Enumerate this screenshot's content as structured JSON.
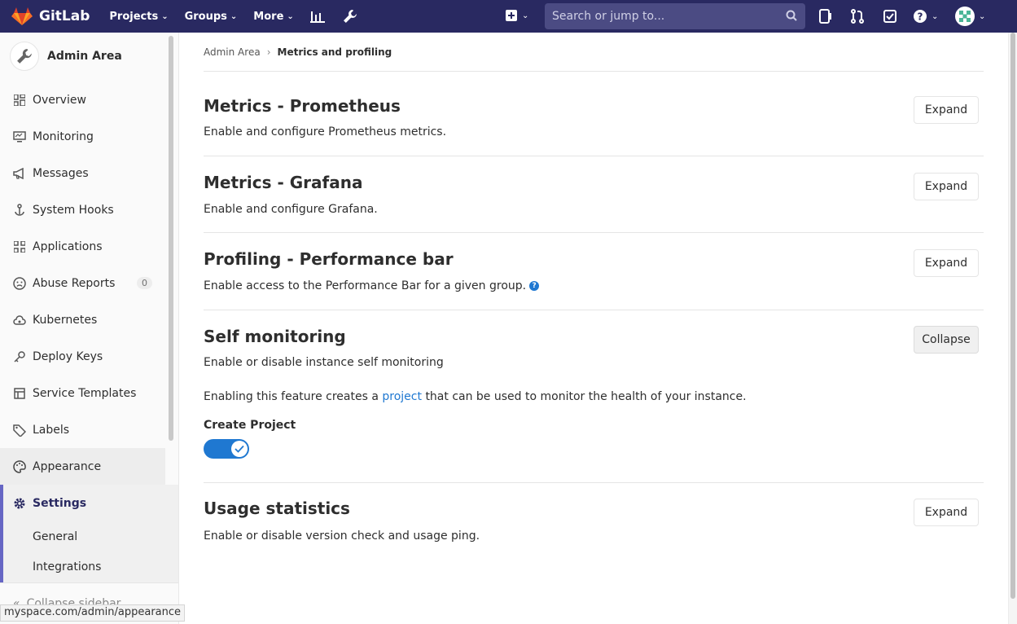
{
  "navbar": {
    "brand": "GitLab",
    "projects": "Projects",
    "groups": "Groups",
    "more": "More",
    "search_placeholder": "Search or jump to..."
  },
  "sidebar": {
    "title": "Admin Area",
    "items": [
      {
        "label": "Overview",
        "icon": "overview-icon"
      },
      {
        "label": "Monitoring",
        "icon": "monitor-icon"
      },
      {
        "label": "Messages",
        "icon": "megaphone-icon"
      },
      {
        "label": "System Hooks",
        "icon": "hook-icon"
      },
      {
        "label": "Applications",
        "icon": "applications-icon"
      },
      {
        "label": "Abuse Reports",
        "icon": "sad-face-icon",
        "badge": "0"
      },
      {
        "label": "Kubernetes",
        "icon": "cloud-gear-icon"
      },
      {
        "label": "Deploy Keys",
        "icon": "key-icon"
      },
      {
        "label": "Service Templates",
        "icon": "template-icon"
      },
      {
        "label": "Labels",
        "icon": "label-icon"
      },
      {
        "label": "Appearance",
        "icon": "palette-icon"
      },
      {
        "label": "Settings",
        "icon": "gear-icon"
      }
    ],
    "sub_items": [
      "General",
      "Integrations"
    ],
    "collapse": "Collapse sidebar"
  },
  "status_url": "myspace.com/admin/appearance",
  "breadcrumb": {
    "parent": "Admin Area",
    "current": "Metrics and profiling"
  },
  "sections": {
    "prometheus": {
      "title": "Metrics - Prometheus",
      "desc": "Enable and configure Prometheus metrics.",
      "button": "Expand"
    },
    "grafana": {
      "title": "Metrics - Grafana",
      "desc": "Enable and configure Grafana.",
      "button": "Expand"
    },
    "profiling": {
      "title": "Profiling - Performance bar",
      "desc": "Enable access to the Performance Bar for a given group.",
      "button": "Expand"
    },
    "self_monitoring": {
      "title": "Self monitoring",
      "desc": "Enable or disable instance self monitoring",
      "button": "Collapse",
      "info_before": "Enabling this feature creates a",
      "info_link": "project",
      "info_after": "that can be used to monitor the health of your instance.",
      "toggle_label": "Create Project",
      "toggle_on": true
    },
    "usage": {
      "title": "Usage statistics",
      "desc": "Enable or disable version check and usage ping.",
      "button": "Expand"
    }
  },
  "colors": {
    "navbar": "#292961",
    "accent": "#1f78d1",
    "active_border": "#6666c4"
  }
}
